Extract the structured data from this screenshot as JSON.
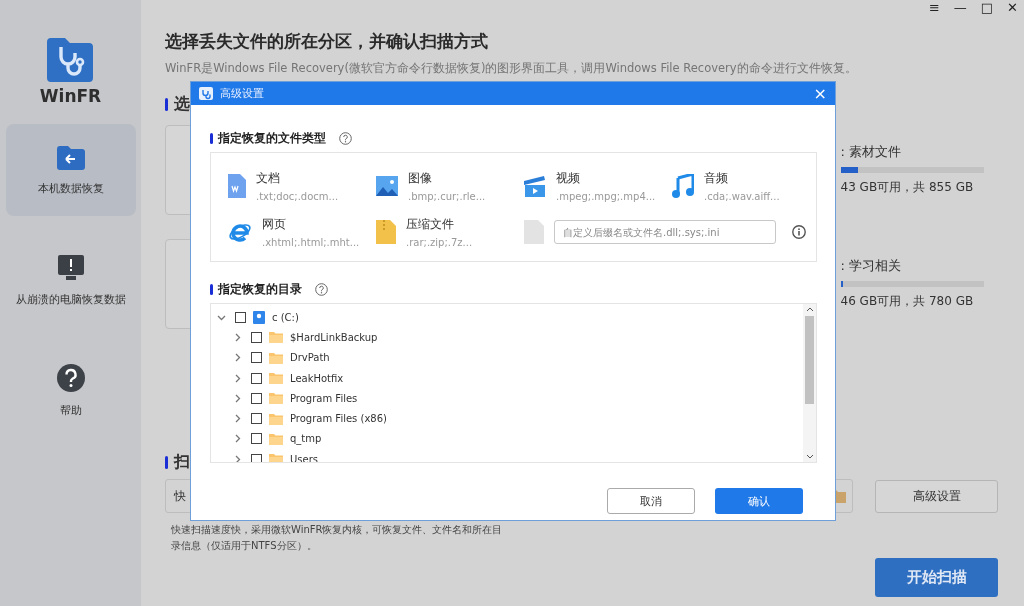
{
  "app": {
    "name": "WinFR"
  },
  "window_controls": [
    "≡",
    "—",
    "□",
    "✕"
  ],
  "sidebar": {
    "items": [
      {
        "label": "本机数据恢复",
        "kind": "local",
        "selected": true
      },
      {
        "label": "从崩溃的电脑恢复数据",
        "kind": "crash",
        "selected": false
      },
      {
        "label": "帮助",
        "kind": "help",
        "selected": false
      }
    ]
  },
  "header": {
    "title": "选择丢失文件的所在分区，并确认扫描方式",
    "subtitle": "WinFR是Windows File Recovery(微软官方命令行数据恢复)的图形界面工具，调用Windows File Recovery的命令进行文件恢复。"
  },
  "partition_section": {
    "heading": "选"
  },
  "drives": [
    {
      "label": ": 素材文件",
      "level": 0.12,
      "space": "43 GB可用，共 855 GB"
    },
    {
      "label": ": 学习相关",
      "level": 0.02,
      "space": "46 GB可用，共 780 GB"
    }
  ],
  "scan_section": {
    "heading": "扫",
    "mode": "快",
    "advanced_button": "高级设置",
    "description": "快速扫描速度快，采用微软WinFR恢复内核，可恢复文件、文件名和所在目录信息（仅适用于NTFS分区）。",
    "start_button": "开始扫描"
  },
  "dialog": {
    "title": "高级设置",
    "close": "×",
    "file_types_heading": "指定恢复的文件类型",
    "file_types": [
      {
        "kind": "doc",
        "name": "文档",
        "extensions": ".txt;doc;.docm..."
      },
      {
        "kind": "image",
        "name": "图像",
        "extensions": ".bmp;.cur;.rle..."
      },
      {
        "kind": "video",
        "name": "视频",
        "extensions": ".mpeg;.mpg;.mp4..."
      },
      {
        "kind": "audio",
        "name": "音频",
        "extensions": ".cda;.wav.aiff..."
      },
      {
        "kind": "web",
        "name": "网页",
        "extensions": ".xhtml;.html;.mht..."
      },
      {
        "kind": "archive",
        "name": "压缩文件",
        "extensions": ".rar;.zip;.7z..."
      }
    ],
    "custom_placeholder": "自定义后缀名或文件名.dll;.sys;.ini",
    "directory_heading": "指定恢复的目录",
    "tree": [
      {
        "label": "c (C:)",
        "kind": "drive",
        "checked": false,
        "expanded": true,
        "children": [
          {
            "label": "$HardLinkBackup",
            "kind": "folder",
            "checked": false,
            "expanded": false
          },
          {
            "label": "DrvPath",
            "kind": "folder",
            "checked": false,
            "expanded": false
          },
          {
            "label": "LeakHotfix",
            "kind": "folder",
            "checked": false,
            "expanded": false
          },
          {
            "label": "Program Files",
            "kind": "folder",
            "checked": false,
            "expanded": false
          },
          {
            "label": "Program Files (x86)",
            "kind": "folder",
            "checked": false,
            "expanded": false
          },
          {
            "label": "q_tmp",
            "kind": "folder",
            "checked": false,
            "expanded": false
          },
          {
            "label": "Users",
            "kind": "folder",
            "checked": false,
            "expanded": false
          }
        ]
      }
    ],
    "cancel_button": "取消",
    "confirm_button": "确认"
  }
}
